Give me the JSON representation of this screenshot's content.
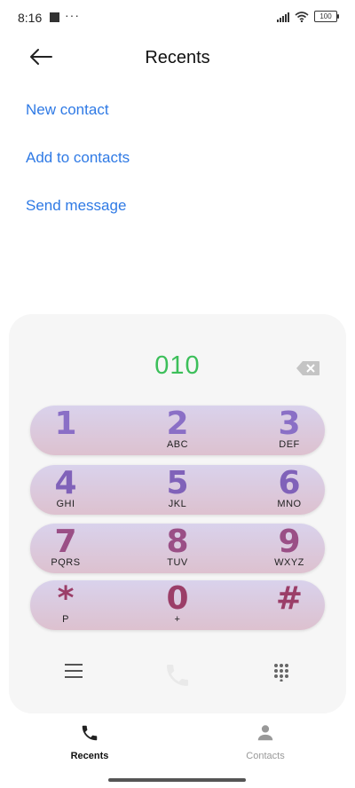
{
  "status_bar": {
    "time": "8:16",
    "dots": "···",
    "battery": "100"
  },
  "header": {
    "title": "Recents"
  },
  "actions": [
    {
      "label": "New contact"
    },
    {
      "label": "Add to contacts"
    },
    {
      "label": "Send message"
    }
  ],
  "dialer": {
    "number": "010",
    "rows": [
      [
        {
          "digit": "1",
          "letters": ""
        },
        {
          "digit": "2",
          "letters": "ABC"
        },
        {
          "digit": "3",
          "letters": "DEF"
        }
      ],
      [
        {
          "digit": "4",
          "letters": "GHI"
        },
        {
          "digit": "5",
          "letters": "JKL"
        },
        {
          "digit": "6",
          "letters": "MNO"
        }
      ],
      [
        {
          "digit": "7",
          "letters": "PQRS"
        },
        {
          "digit": "8",
          "letters": "TUV"
        },
        {
          "digit": "9",
          "letters": "WXYZ"
        }
      ],
      [
        {
          "digit": "*",
          "letters": "P"
        },
        {
          "digit": "0",
          "letters": "+"
        },
        {
          "digit": "#",
          "letters": ""
        }
      ]
    ]
  },
  "bottom_nav": {
    "recents_label": "Recents",
    "contacts_label": "Contacts"
  },
  "colors": {
    "accent": "#2f7ae5",
    "number": "#3cbf5a",
    "keypad_top": "#d9d2ec",
    "keypad_bottom": "#ddc1cf"
  }
}
